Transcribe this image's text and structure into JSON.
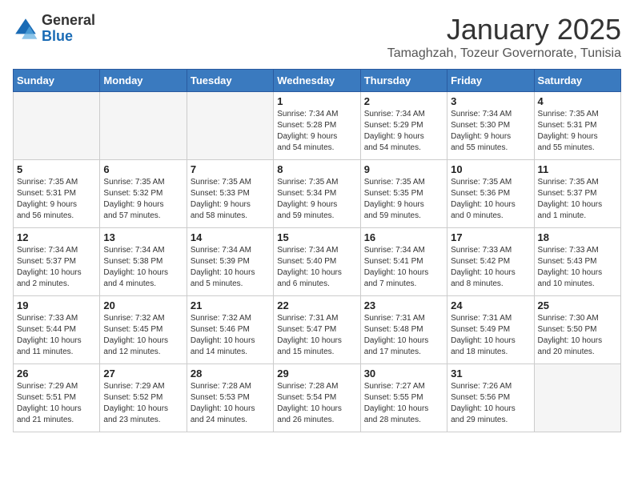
{
  "header": {
    "logo_general": "General",
    "logo_blue": "Blue",
    "title": "January 2025",
    "subtitle": "Tamaghzah, Tozeur Governorate, Tunisia"
  },
  "days_of_week": [
    "Sunday",
    "Monday",
    "Tuesday",
    "Wednesday",
    "Thursday",
    "Friday",
    "Saturday"
  ],
  "weeks": [
    [
      {
        "day": "",
        "info": ""
      },
      {
        "day": "",
        "info": ""
      },
      {
        "day": "",
        "info": ""
      },
      {
        "day": "1",
        "info": "Sunrise: 7:34 AM\nSunset: 5:28 PM\nDaylight: 9 hours\nand 54 minutes."
      },
      {
        "day": "2",
        "info": "Sunrise: 7:34 AM\nSunset: 5:29 PM\nDaylight: 9 hours\nand 54 minutes."
      },
      {
        "day": "3",
        "info": "Sunrise: 7:34 AM\nSunset: 5:30 PM\nDaylight: 9 hours\nand 55 minutes."
      },
      {
        "day": "4",
        "info": "Sunrise: 7:35 AM\nSunset: 5:31 PM\nDaylight: 9 hours\nand 55 minutes."
      }
    ],
    [
      {
        "day": "5",
        "info": "Sunrise: 7:35 AM\nSunset: 5:31 PM\nDaylight: 9 hours\nand 56 minutes."
      },
      {
        "day": "6",
        "info": "Sunrise: 7:35 AM\nSunset: 5:32 PM\nDaylight: 9 hours\nand 57 minutes."
      },
      {
        "day": "7",
        "info": "Sunrise: 7:35 AM\nSunset: 5:33 PM\nDaylight: 9 hours\nand 58 minutes."
      },
      {
        "day": "8",
        "info": "Sunrise: 7:35 AM\nSunset: 5:34 PM\nDaylight: 9 hours\nand 59 minutes."
      },
      {
        "day": "9",
        "info": "Sunrise: 7:35 AM\nSunset: 5:35 PM\nDaylight: 9 hours\nand 59 minutes."
      },
      {
        "day": "10",
        "info": "Sunrise: 7:35 AM\nSunset: 5:36 PM\nDaylight: 10 hours\nand 0 minutes."
      },
      {
        "day": "11",
        "info": "Sunrise: 7:35 AM\nSunset: 5:37 PM\nDaylight: 10 hours\nand 1 minute."
      }
    ],
    [
      {
        "day": "12",
        "info": "Sunrise: 7:34 AM\nSunset: 5:37 PM\nDaylight: 10 hours\nand 2 minutes."
      },
      {
        "day": "13",
        "info": "Sunrise: 7:34 AM\nSunset: 5:38 PM\nDaylight: 10 hours\nand 4 minutes."
      },
      {
        "day": "14",
        "info": "Sunrise: 7:34 AM\nSunset: 5:39 PM\nDaylight: 10 hours\nand 5 minutes."
      },
      {
        "day": "15",
        "info": "Sunrise: 7:34 AM\nSunset: 5:40 PM\nDaylight: 10 hours\nand 6 minutes."
      },
      {
        "day": "16",
        "info": "Sunrise: 7:34 AM\nSunset: 5:41 PM\nDaylight: 10 hours\nand 7 minutes."
      },
      {
        "day": "17",
        "info": "Sunrise: 7:33 AM\nSunset: 5:42 PM\nDaylight: 10 hours\nand 8 minutes."
      },
      {
        "day": "18",
        "info": "Sunrise: 7:33 AM\nSunset: 5:43 PM\nDaylight: 10 hours\nand 10 minutes."
      }
    ],
    [
      {
        "day": "19",
        "info": "Sunrise: 7:33 AM\nSunset: 5:44 PM\nDaylight: 10 hours\nand 11 minutes."
      },
      {
        "day": "20",
        "info": "Sunrise: 7:32 AM\nSunset: 5:45 PM\nDaylight: 10 hours\nand 12 minutes."
      },
      {
        "day": "21",
        "info": "Sunrise: 7:32 AM\nSunset: 5:46 PM\nDaylight: 10 hours\nand 14 minutes."
      },
      {
        "day": "22",
        "info": "Sunrise: 7:31 AM\nSunset: 5:47 PM\nDaylight: 10 hours\nand 15 minutes."
      },
      {
        "day": "23",
        "info": "Sunrise: 7:31 AM\nSunset: 5:48 PM\nDaylight: 10 hours\nand 17 minutes."
      },
      {
        "day": "24",
        "info": "Sunrise: 7:31 AM\nSunset: 5:49 PM\nDaylight: 10 hours\nand 18 minutes."
      },
      {
        "day": "25",
        "info": "Sunrise: 7:30 AM\nSunset: 5:50 PM\nDaylight: 10 hours\nand 20 minutes."
      }
    ],
    [
      {
        "day": "26",
        "info": "Sunrise: 7:29 AM\nSunset: 5:51 PM\nDaylight: 10 hours\nand 21 minutes."
      },
      {
        "day": "27",
        "info": "Sunrise: 7:29 AM\nSunset: 5:52 PM\nDaylight: 10 hours\nand 23 minutes."
      },
      {
        "day": "28",
        "info": "Sunrise: 7:28 AM\nSunset: 5:53 PM\nDaylight: 10 hours\nand 24 minutes."
      },
      {
        "day": "29",
        "info": "Sunrise: 7:28 AM\nSunset: 5:54 PM\nDaylight: 10 hours\nand 26 minutes."
      },
      {
        "day": "30",
        "info": "Sunrise: 7:27 AM\nSunset: 5:55 PM\nDaylight: 10 hours\nand 28 minutes."
      },
      {
        "day": "31",
        "info": "Sunrise: 7:26 AM\nSunset: 5:56 PM\nDaylight: 10 hours\nand 29 minutes."
      },
      {
        "day": "",
        "info": ""
      }
    ]
  ]
}
